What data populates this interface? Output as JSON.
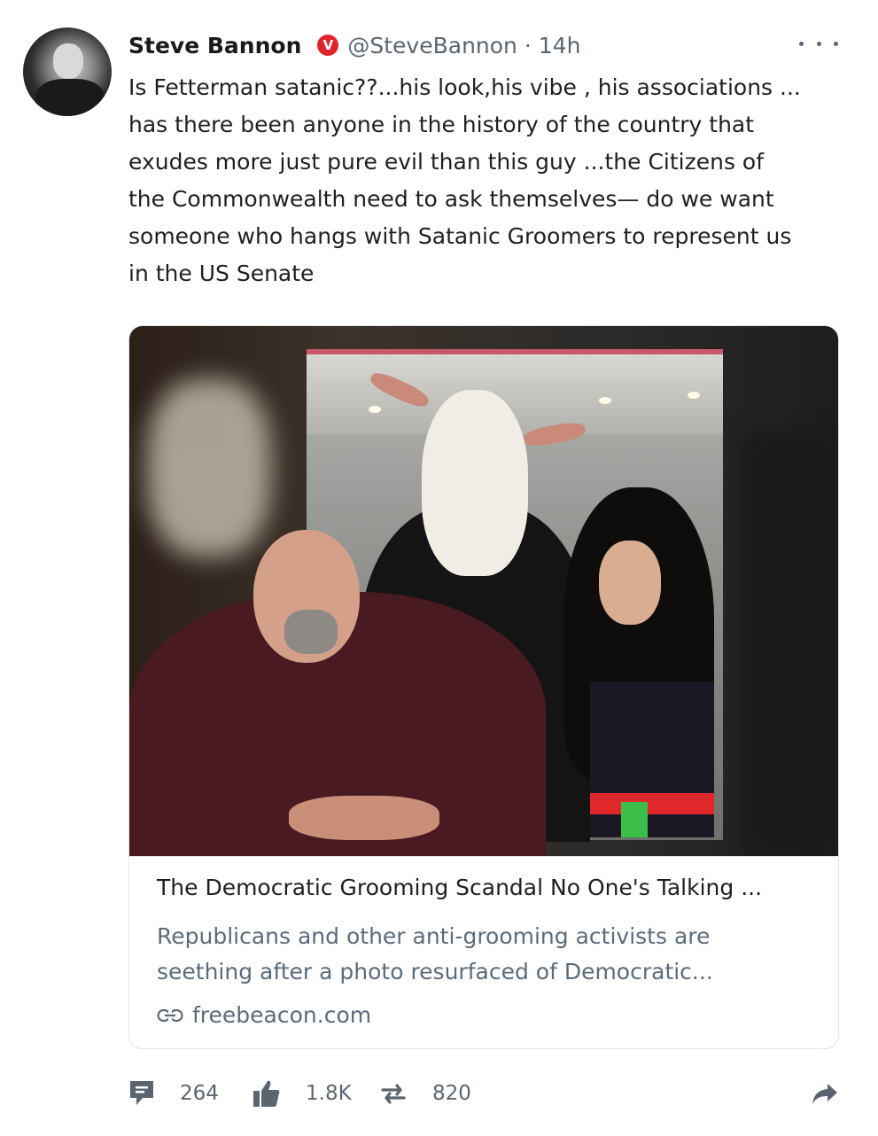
{
  "author": {
    "name": "Steve Bannon",
    "verified_badge": "V",
    "handle": "@SteveBannon",
    "separator": "·",
    "time": "14h"
  },
  "tweet": {
    "text": "Is Fetterman satanic??...his look,his vibe , his associations ...\nhas there been anyone in the history of the country that\nexudes more just pure evil than this guy ...the Citizens  of\nthe Commonwealth need to ask themselves— do we want\nsomeone who hangs  with Satanic Groomers to represent us\nin the US Senate"
  },
  "card": {
    "title": "The Democratic Grooming Scandal No One's Talking ...",
    "description": "Republicans and other anti-grooming activists are\nseething after a photo resurfaced of Democratic...",
    "domain": "freebeacon.com",
    "link_icon": "link-icon"
  },
  "actions": {
    "comments": "264",
    "likes": "1.8K",
    "reposts": "820"
  },
  "icons": {
    "more": "more-dots-icon",
    "comment": "comment-icon",
    "like": "thumbs-up-icon",
    "repost": "repost-icon",
    "share": "share-arrow-icon"
  },
  "colors": {
    "badge": "#e0242a",
    "muted": "#5b6570",
    "link_text": "#5b6b7c"
  }
}
